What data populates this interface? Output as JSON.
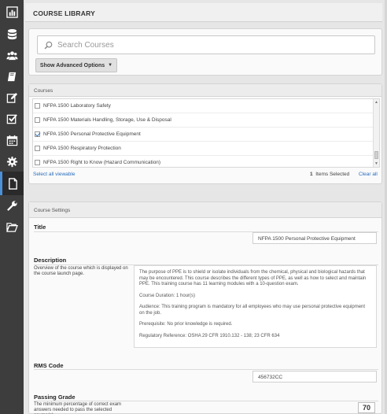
{
  "sidebar": {
    "icons": [
      "bar-chart-icon",
      "database-icon",
      "users-icon",
      "book-icon",
      "edit-icon",
      "checklist-icon",
      "calendar-icon",
      "gear-icon",
      "document-icon",
      "wrench-icon",
      "folder-open-icon"
    ],
    "active_index": 8
  },
  "header": {
    "title": "COURSE LIBRARY"
  },
  "search": {
    "placeholder": "Search Courses",
    "advanced_label": "Show Advanced Options"
  },
  "courses": {
    "header": "Courses",
    "items": [
      {
        "label": "NFPA 1500 Laboratory Safety",
        "checked": false
      },
      {
        "label": "NFPA 1500 Materials Handling, Storage, Use & Disposal",
        "checked": false
      },
      {
        "label": "NFPA 1500 Personal Protective Equipment",
        "checked": true
      },
      {
        "label": "NFPA 1500 Respiratory Protection",
        "checked": false
      },
      {
        "label": "NFPA 1500 Right to Know (Hazard Communication)",
        "checked": false
      }
    ],
    "select_all_label": "Select all viewable",
    "selected_count": "1",
    "selected_suffix": "Items Selected",
    "clear_all_label": "Clear all"
  },
  "settings": {
    "header": "Course Settings",
    "title_label": "Title",
    "title_value": "NFPA 1500 Personal Protective Equipment",
    "description_label": "Description",
    "description_help": "Overview of the course which is displayed on the course launch page.",
    "description_paragraphs": [
      "The purpose of PPE is to shield or isolate individuals from the chemical, physical and biological hazards that may be encountered. This course describes the different types of PPE, as well as how to select and maintain PPE. This training course has 11 learning modules with a 10-question exam.",
      "Course Duration: 1 hour(s)",
      "Audience: This training program is mandatory for all employees who may use personal protective equipment on the job.",
      "Prerequisite: No prior knowledge is required.",
      "Regulatory Reference: OSHA 29 CFR 1910.132 - 138;  23 CFR 634"
    ],
    "rms_label": "RMS Code",
    "rms_value": "456732CC",
    "passing_label": "Passing Grade",
    "passing_help": "The minimum percentage of correct exam answers needed to pass the selected course(s).",
    "passing_value": "70"
  }
}
